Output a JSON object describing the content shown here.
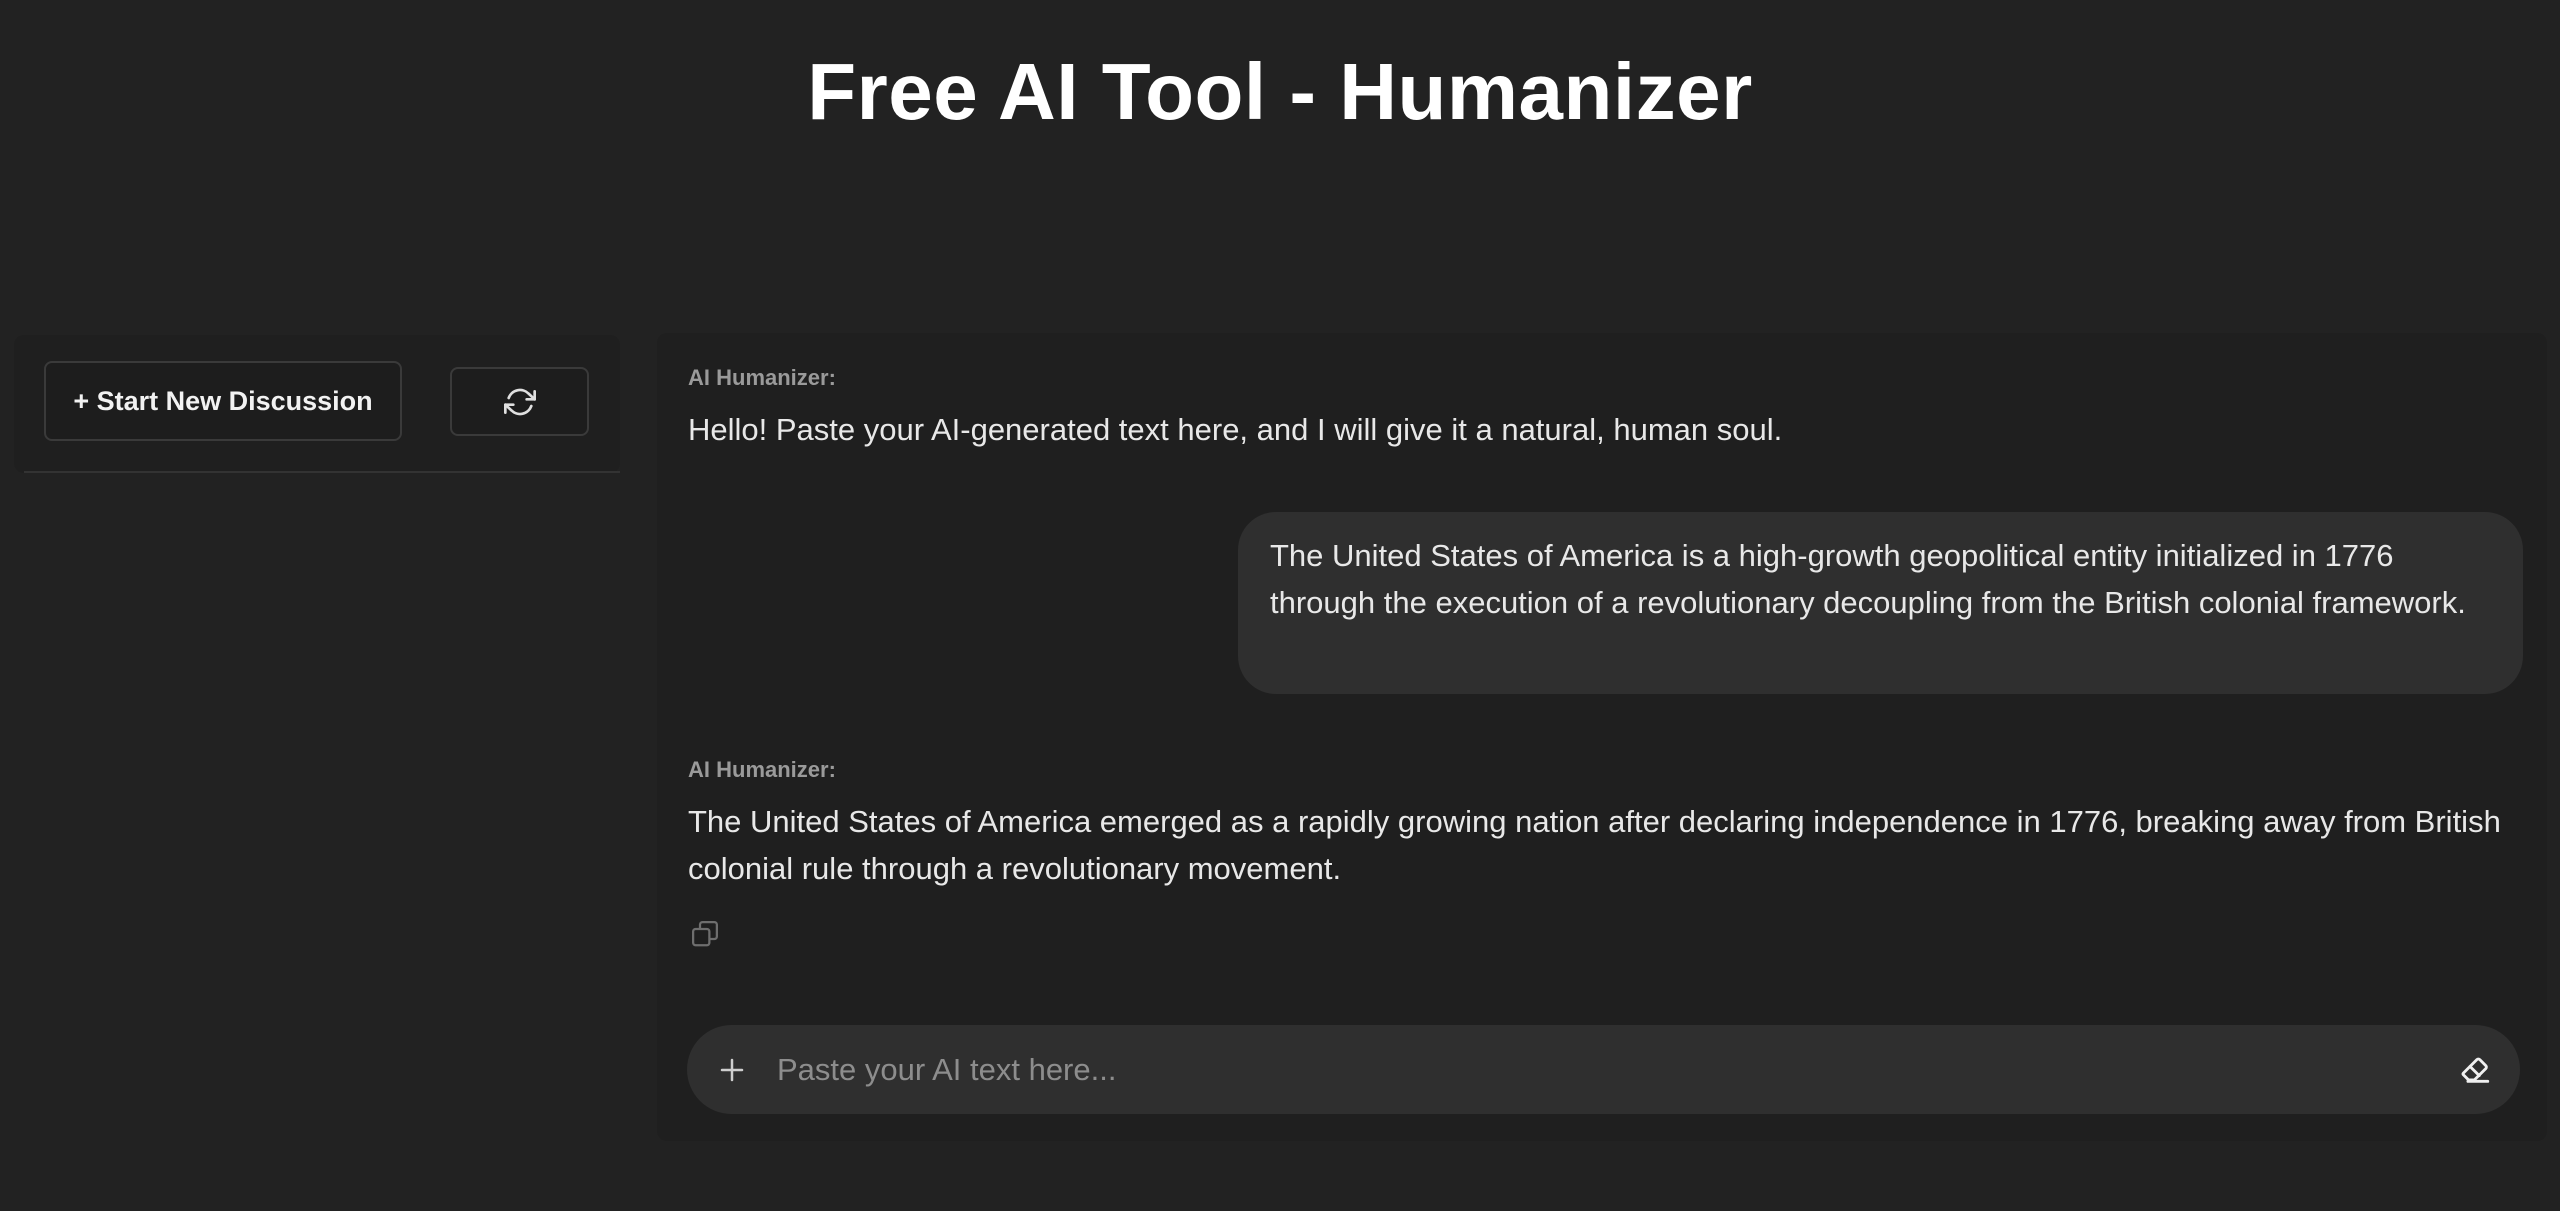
{
  "header": {
    "title": "Free AI Tool - Humanizer"
  },
  "sidebar": {
    "new_discussion_label": "+ Start New Discussion",
    "refresh_icon": "refresh-icon"
  },
  "chat": {
    "messages": [
      {
        "role": "assistant",
        "sender": "AI Humanizer:",
        "text": "Hello! Paste your AI-generated text here, and I will give it a natural, human soul."
      },
      {
        "role": "user",
        "text": "The United States of America is a high-growth geopolitical entity initialized in 1776 through the execution of a revolutionary decoupling from the British colonial framework."
      },
      {
        "role": "assistant",
        "sender": "AI Humanizer:",
        "text": "The United States of America emerged as a rapidly growing nation after declaring independence in 1776, breaking away from British colonial rule through a revolutionary movement.",
        "copy_icon": "copy-icon"
      }
    ]
  },
  "composer": {
    "placeholder": "Paste your AI text here...",
    "value": "",
    "attach_icon": "plus-icon",
    "clear_icon": "eraser-icon"
  },
  "colors": {
    "background": "#222222",
    "panel": "#1f1f1f",
    "bubble": "#2f2f2f",
    "label": "#9a9a9a"
  }
}
